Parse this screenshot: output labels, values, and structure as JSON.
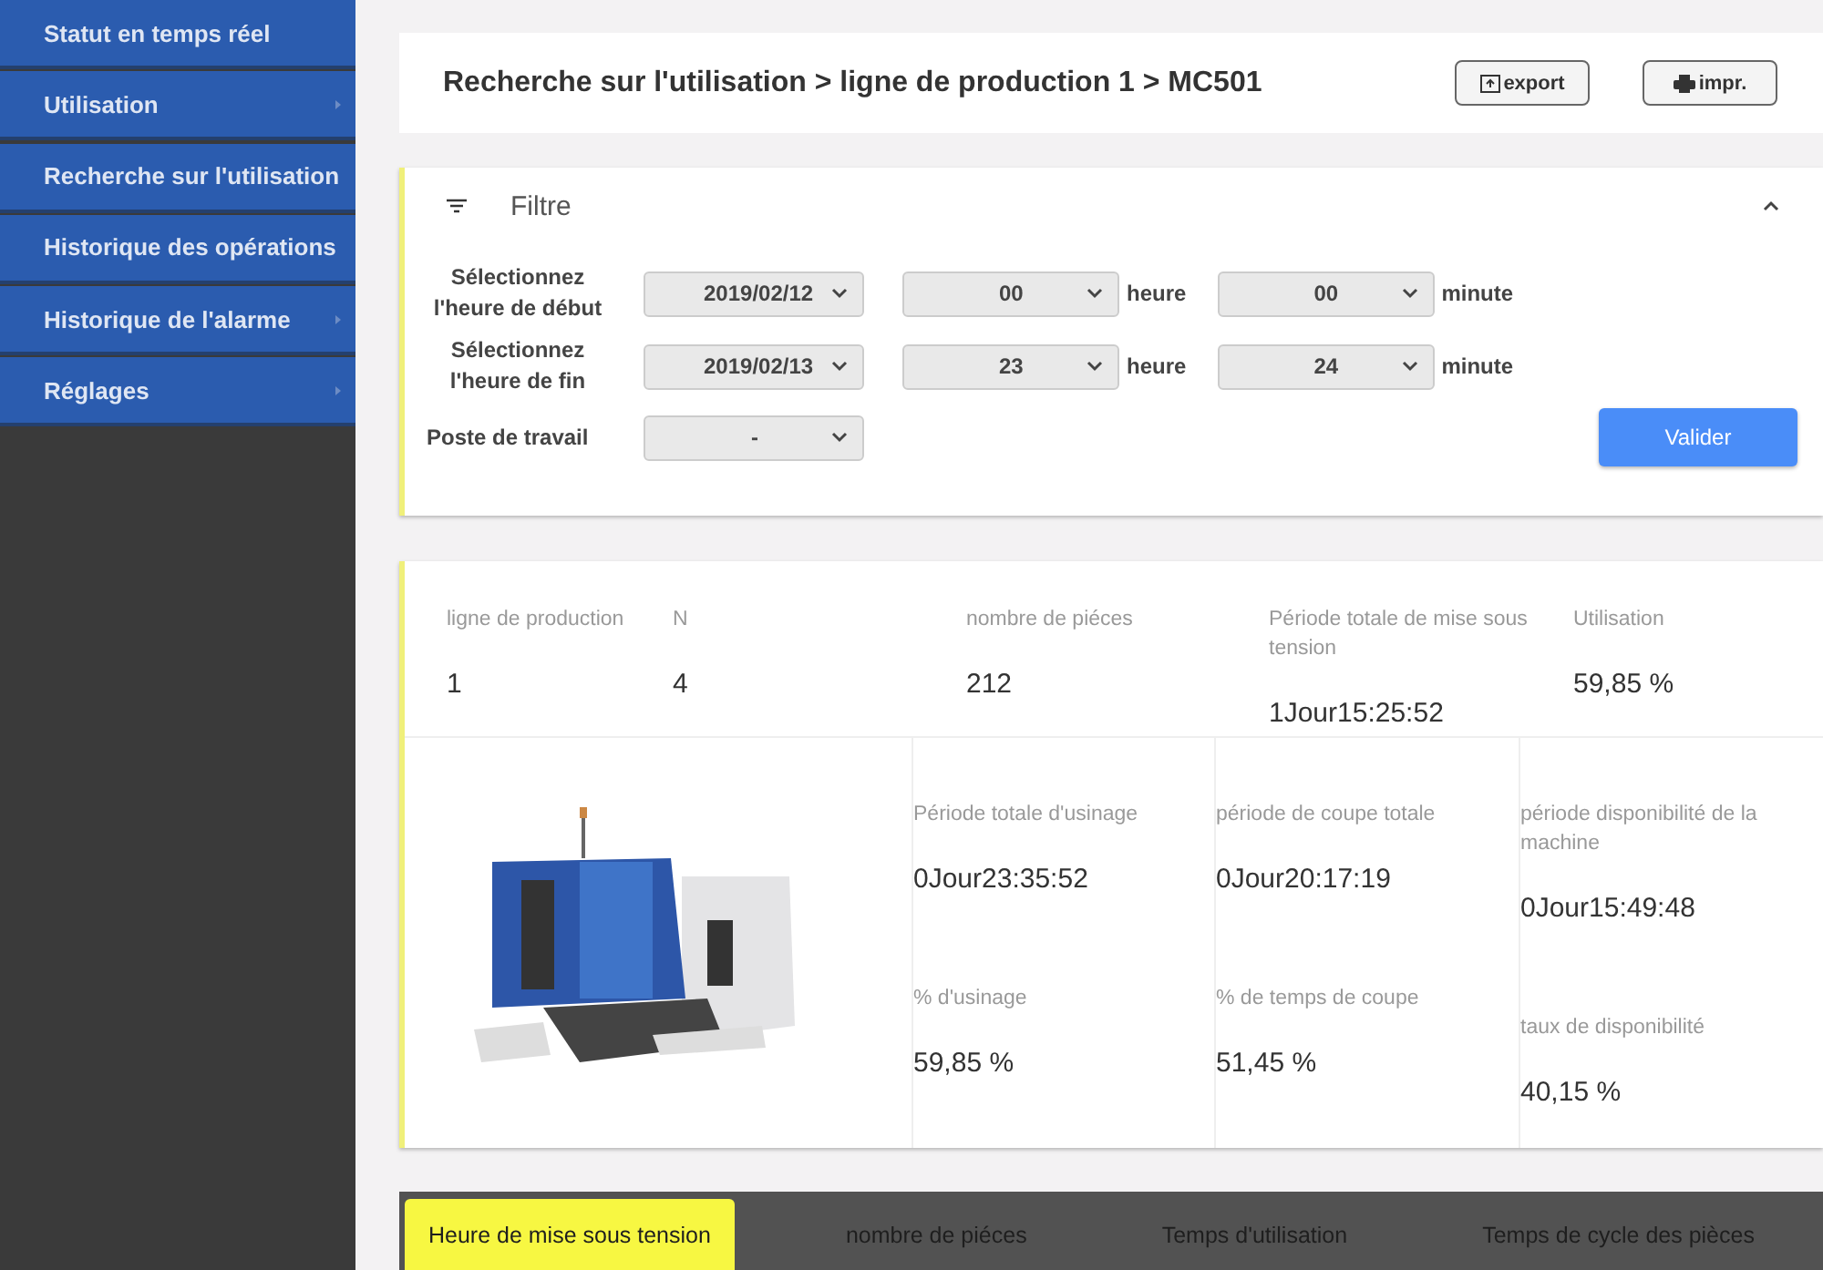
{
  "sidebar": {
    "items": [
      {
        "label": "Statut en temps réel",
        "has_submenu": false
      },
      {
        "label": "Utilisation",
        "has_submenu": true
      },
      {
        "label": "Recherche sur l'utilisation",
        "has_submenu": false
      },
      {
        "label": "Historique des opérations",
        "has_submenu": false
      },
      {
        "label": "Historique de l'alarme",
        "has_submenu": true
      },
      {
        "label": "Réglages",
        "has_submenu": true
      }
    ]
  },
  "header": {
    "breadcrumb": "Recherche sur l'utilisation > ligne de production 1 > MC501",
    "buttons": [
      {
        "label": "export",
        "kind": "export"
      },
      {
        "label": "impr.",
        "kind": "print"
      }
    ]
  },
  "filter": {
    "title": "Filtre",
    "expanded": true,
    "rows": [
      {
        "label": "Sélectionnez l'heure de début",
        "date": "2019/02/12",
        "hour": "00",
        "hour_unit": "heure",
        "minute": "00",
        "minute_unit": "minute"
      },
      {
        "label": "Sélectionnez l'heure de fin",
        "date": "2019/02/13",
        "hour": "23",
        "hour_unit": "heure",
        "minute": "24",
        "minute_unit": "minute"
      }
    ],
    "workstation": {
      "label": "Poste de travail",
      "value": "-"
    },
    "submit": "Valider"
  },
  "summary": {
    "top": [
      {
        "label": "ligne de production",
        "value": "1"
      },
      {
        "label": "N",
        "value": "4"
      },
      {
        "label": "nombre de piéces",
        "value": "212"
      },
      {
        "label": "Période totale de mise sous tension",
        "value": "1Jour15:25:52"
      },
      {
        "label": "Utilisation",
        "value": "59,85 %"
      }
    ],
    "columns": [
      [
        {
          "label": "Période totale d'usinage",
          "value": "0Jour23:35:52"
        },
        {
          "label": "% d'usinage",
          "value": "59,85 %"
        }
      ],
      [
        {
          "label": "période de coupe totale",
          "value": "0Jour20:17:19"
        },
        {
          "label": "% de temps de coupe",
          "value": "51,45 %"
        }
      ],
      [
        {
          "label": "période disponibilité de la machine",
          "value": "0Jour15:49:48"
        },
        {
          "label": "taux de disponibilité",
          "value": "40,15 %"
        }
      ]
    ]
  },
  "tabs": [
    {
      "label": "Heure de mise sous tension",
      "selected": true
    },
    {
      "label": "nombre de piéces",
      "selected": false
    },
    {
      "label": "Temps d'utilisation",
      "selected": false
    },
    {
      "label": "Temps de cycle des pièces",
      "selected": false
    }
  ]
}
